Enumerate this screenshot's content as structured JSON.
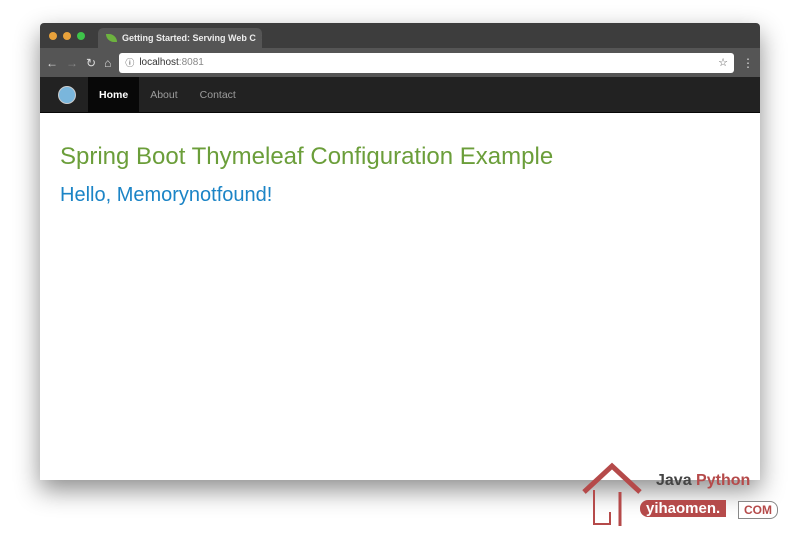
{
  "browser": {
    "tab_title": "Getting Started: Serving Web C",
    "url_host": "localhost",
    "url_port": ":8081"
  },
  "navbar": {
    "items": [
      {
        "label": "Home",
        "active": true
      },
      {
        "label": "About"
      },
      {
        "label": "Contact"
      }
    ]
  },
  "content": {
    "title": "Spring Boot Thymeleaf Configuration Example",
    "greeting": "Hello, Memorynotfound!"
  },
  "colors": {
    "title": "#6b9e3a",
    "greeting": "#1b84c6",
    "navbar": "#222222"
  },
  "watermark": {
    "line1a": "Java",
    "line1b": "Python",
    "line2": "yihaomen.",
    "line3": "COM"
  }
}
